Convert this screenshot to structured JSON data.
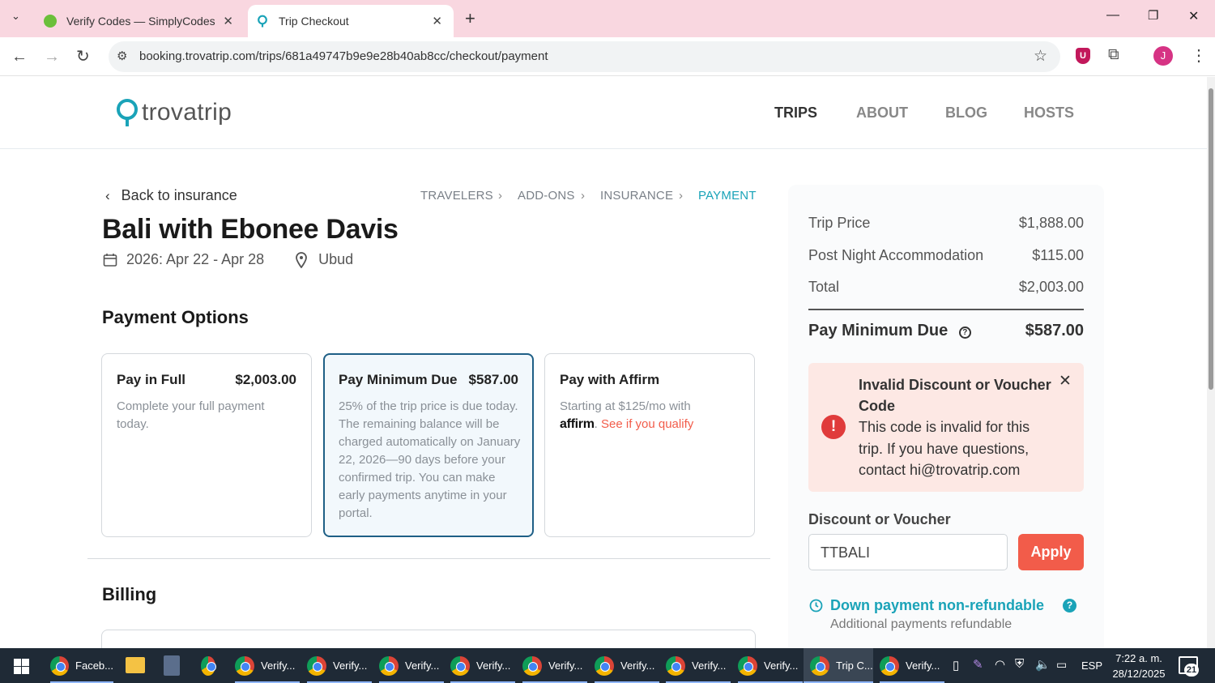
{
  "browser": {
    "tabs": [
      {
        "title": "Verify Codes — SimplyCodes"
      },
      {
        "title": "Trip Checkout"
      }
    ],
    "url": "booking.trovatrip.com/trips/681a49747b9e9e28b40ab8cc/checkout/payment",
    "profile_initial": "J"
  },
  "site": {
    "logo": "trovatrip",
    "nav": [
      "TRIPS",
      "ABOUT",
      "BLOG",
      "HOSTS"
    ]
  },
  "checkout": {
    "back_link": "Back to insurance",
    "steps": [
      "TRAVELERS",
      "ADD-ONS",
      "INSURANCE",
      "PAYMENT"
    ],
    "trip_title": "Bali with Ebonee Davis",
    "dates": "2026: Apr 22 - Apr 28",
    "location": "Ubud",
    "payment_options_heading": "Payment Options",
    "options": [
      {
        "title": "Pay in Full",
        "price": "$2,003.00",
        "desc": "Complete your full payment today."
      },
      {
        "title": "Pay Minimum Due",
        "price": "$587.00",
        "desc": "25% of the trip price is due today. The remaining balance will be charged automatically on January 22, 2026—90 days before your confirmed trip. You can make early payments anytime in your portal."
      },
      {
        "title": "Pay with Affirm",
        "price": "",
        "desc": "Starting at $125/mo with",
        "affirm_logo": "affirm",
        "affirm_suffix": ".",
        "qualify_link": "See if you qualify"
      }
    ],
    "billing_heading": "Billing"
  },
  "summary": {
    "rows": [
      {
        "label": "Trip Price",
        "value": "$1,888.00"
      },
      {
        "label": "Post Night Accommodation",
        "value": "$115.00"
      },
      {
        "label": "Total",
        "value": "$2,003.00"
      }
    ],
    "min_due_label": "Pay Minimum Due",
    "min_due_value": "$587.00",
    "alert": {
      "title": "Invalid Discount or Voucher Code",
      "body": "This code is invalid for this trip. If you have questions, contact hi@trovatrip.com"
    },
    "discount_label": "Discount or Voucher",
    "discount_value": "TTBALI",
    "apply_label": "Apply",
    "refund_title": "Down payment non-refundable",
    "refund_sub": "Additional payments refundable"
  },
  "taskbar": {
    "items": [
      "Faceb...",
      "Verify...",
      "Verify...",
      "Verify...",
      "Verify...",
      "Verify...",
      "Verify...",
      "Verify...",
      "Verify...",
      "Trip C...",
      "Verify..."
    ],
    "lang": "ESP",
    "time": "7:22 a. m.",
    "date": "28/12/2025",
    "notif_count": "21"
  },
  "colors": {
    "brand_teal": "#1aa3b8",
    "apply_red": "#f25c4a",
    "alert_bg": "#fde8e4",
    "alert_icon": "#e03b3b",
    "selected_card": "#f2f8fc"
  }
}
